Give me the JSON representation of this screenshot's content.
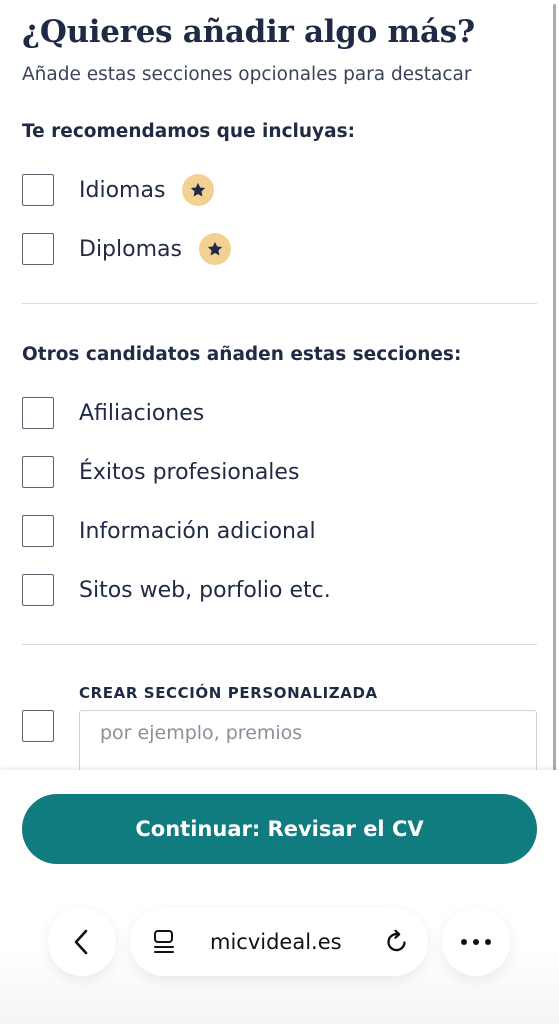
{
  "header": {
    "title": "¿Quieres añadir algo más?",
    "subtitle": "Añade estas secciones opcionales para destacar"
  },
  "recommended": {
    "heading": "Te recomendamos que incluyas:",
    "items": [
      {
        "label": "Idiomas",
        "checked": false,
        "badge": "star-icon"
      },
      {
        "label": "Diplomas",
        "checked": false,
        "badge": "star-icon"
      }
    ]
  },
  "others": {
    "heading": "Otros candidatos añaden estas secciones:",
    "items": [
      {
        "label": "Afiliaciones",
        "checked": false
      },
      {
        "label": "Éxitos profesionales",
        "checked": false
      },
      {
        "label": "Información adicional",
        "checked": false
      },
      {
        "label": "Sitos web, porfolio etc.",
        "checked": false
      }
    ]
  },
  "custom": {
    "label": "CREAR SECCIÓN PERSONALIZADA",
    "checked": false,
    "value": "",
    "placeholder": "por ejemplo, premios"
  },
  "cta": {
    "label": "Continuar: Revisar el CV"
  },
  "browser": {
    "url": "micvideal.es",
    "icons": [
      "back-chevron-icon",
      "reader-mode-icon",
      "reload-icon",
      "more-dots-icon"
    ]
  },
  "colors": {
    "primary_text": "#1f2a44",
    "accent": "#107c80",
    "badge_bg": "#f2d192",
    "divider": "#d7d9dd"
  }
}
